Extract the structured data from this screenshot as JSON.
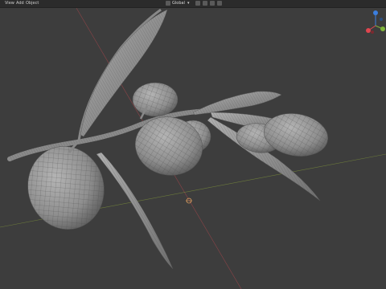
{
  "header": {
    "menu": [
      "View",
      "Add",
      "Object"
    ],
    "transform_orientation": "Global",
    "dropdown_arrow": "chevron-down-icon"
  },
  "colors": {
    "viewport_bg": "#3d3d3d",
    "header_bg": "#2b2b2b",
    "mesh_fill": "#9a9a9a",
    "wire": "#4a4a4a",
    "axis_x": "#c0484f",
    "axis_y": "#8aa23a",
    "gizmo_x": "#e0464f",
    "gizmo_y": "#7fb53a",
    "gizmo_z": "#3b7fe0"
  },
  "viewport": {
    "object": "olive branch mesh (wireframe over solid)"
  }
}
